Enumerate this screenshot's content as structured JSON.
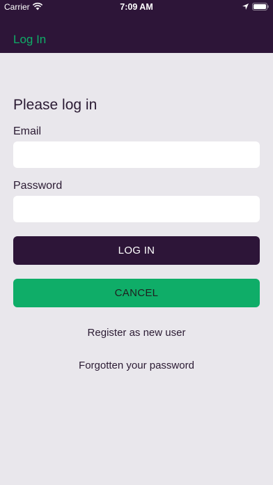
{
  "status_bar": {
    "carrier": "Carrier",
    "time": "7:09 AM",
    "icons": [
      "wifi-icon",
      "location-arrow-icon",
      "battery-icon"
    ]
  },
  "nav": {
    "title": "Log In"
  },
  "form": {
    "heading": "Please log in",
    "email_label": "Email",
    "email_value": "",
    "password_label": "Password",
    "password_value": "",
    "login_button": "LOG IN",
    "cancel_button": "CANCEL"
  },
  "links": {
    "register": "Register as new user",
    "forgot": "Forgotten your password"
  },
  "colors": {
    "header": "#2d1538",
    "accent_green": "#0fad68",
    "background": "#e9e7ec"
  }
}
